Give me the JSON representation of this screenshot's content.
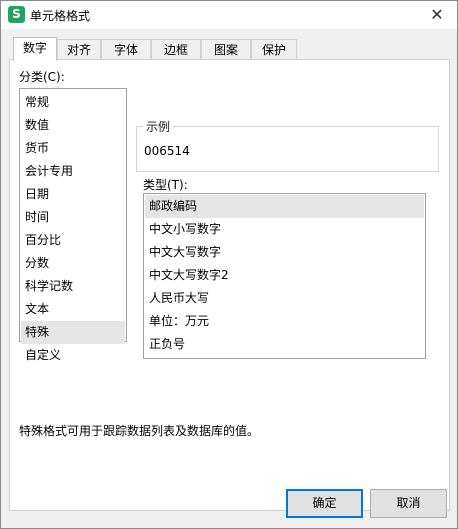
{
  "window": {
    "title": "单元格格式",
    "app_icon_text": "S",
    "close_glyph": "✕"
  },
  "tabs": [
    {
      "label": "数字"
    },
    {
      "label": "对齐"
    },
    {
      "label": "字体"
    },
    {
      "label": "边框"
    },
    {
      "label": "图案"
    },
    {
      "label": "保护"
    }
  ],
  "category": {
    "label": "分类(C):",
    "items": [
      "常规",
      "数值",
      "货币",
      "会计专用",
      "日期",
      "时间",
      "百分比",
      "分数",
      "科学记数",
      "文本",
      "特殊",
      "自定义"
    ],
    "selected": "特殊"
  },
  "sample": {
    "title": "示例",
    "value": "006514"
  },
  "type": {
    "label": "类型(T):",
    "items": [
      "邮政编码",
      "中文小写数字",
      "中文大写数字",
      "中文大写数字2",
      "人民币大写",
      "单位：万元",
      "正负号"
    ],
    "selected": "邮政编码"
  },
  "description": "特殊格式可用于跟踪数据列表及数据库的值。",
  "buttons": {
    "ok": "确定",
    "cancel": "取消"
  },
  "colors": {
    "accent": "#0078d7",
    "app_icon": "#21a366",
    "selection": "#e5e5e5"
  }
}
